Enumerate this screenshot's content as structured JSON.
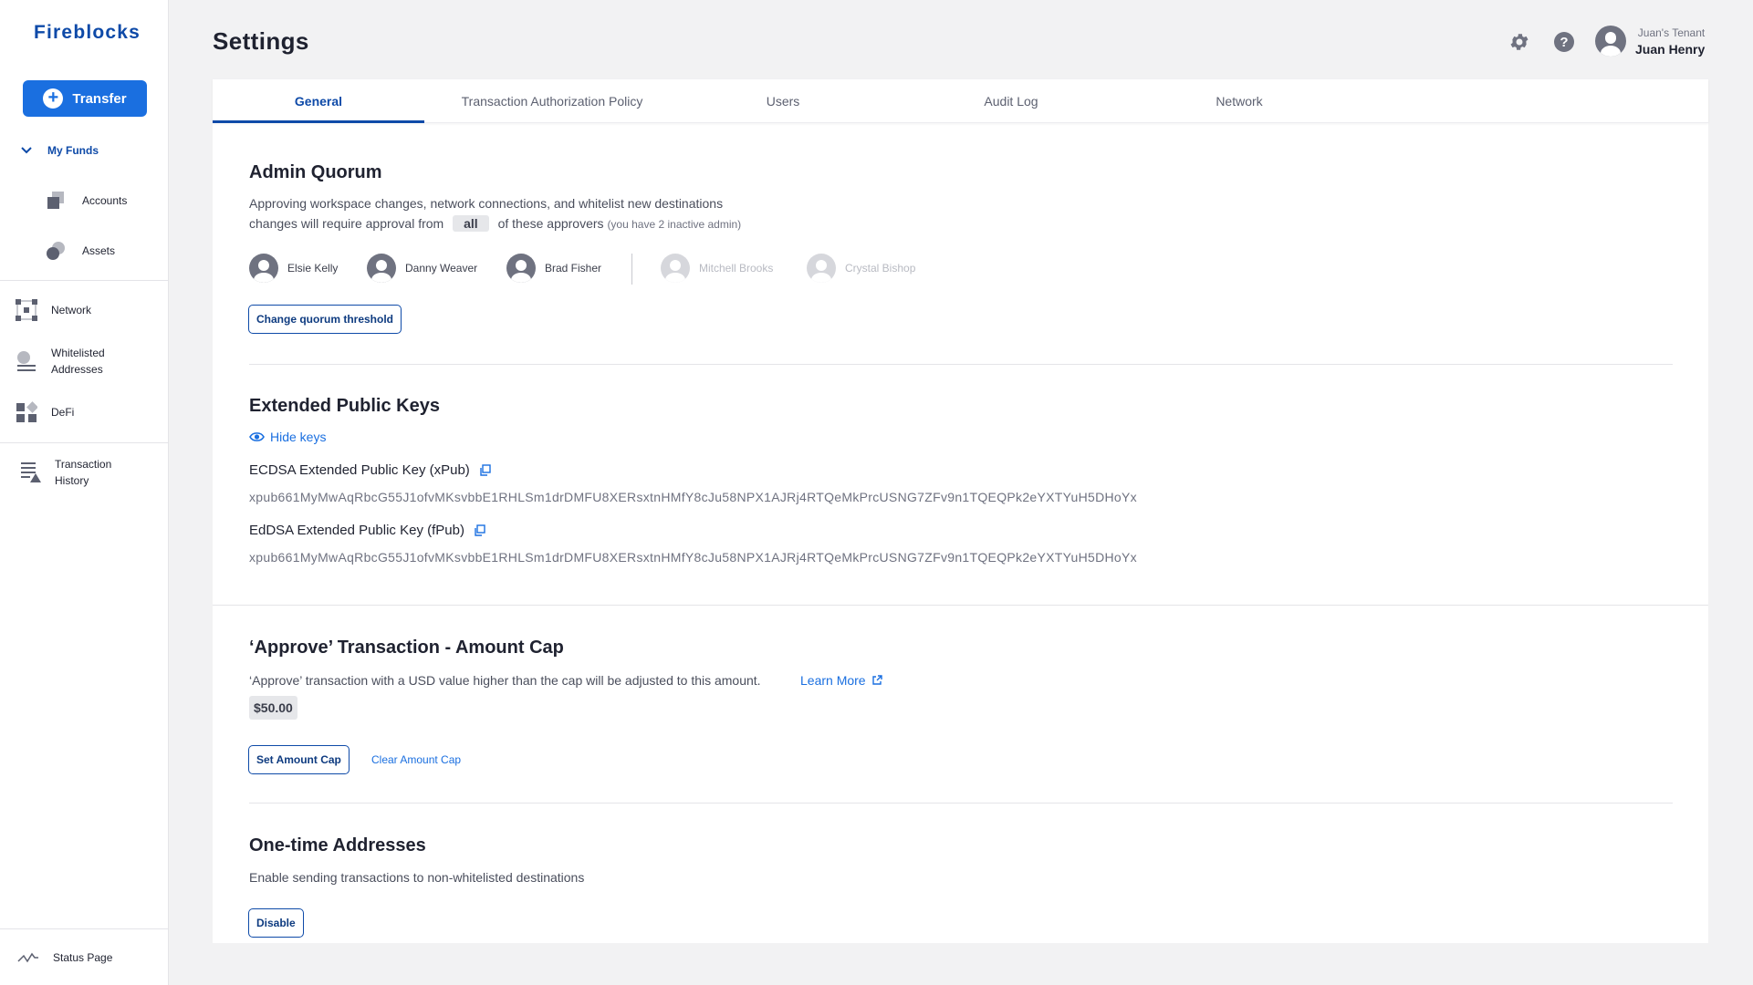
{
  "app": {
    "logo": "Fireblocks"
  },
  "sidebar": {
    "transfer_label": "Transfer",
    "my_funds": "My Funds",
    "items": [
      {
        "label": "Accounts",
        "icon": "accounts-icon"
      },
      {
        "label": "Assets",
        "icon": "assets-icon"
      },
      {
        "label": "Network",
        "icon": "network-icon"
      },
      {
        "label": "Whitelisted Addresses",
        "icon": "whitelist-icon"
      },
      {
        "label": "DeFi",
        "icon": "defi-icon"
      },
      {
        "label": "Transaction History",
        "icon": "history-icon"
      }
    ],
    "status_page": "Status Page"
  },
  "header": {
    "title": "Settings",
    "tenant": "Juan's Tenant",
    "user_name": "Juan Henry"
  },
  "tabs": [
    {
      "label": "General",
      "active": true
    },
    {
      "label": "Transaction Authorization Policy",
      "active": false
    },
    {
      "label": "Users",
      "active": false
    },
    {
      "label": "Audit Log",
      "active": false
    },
    {
      "label": "Network",
      "active": false
    }
  ],
  "quorum": {
    "title": "Admin Quorum",
    "line1": "Approving workspace changes, network  connections, and whitelist new destinations",
    "line2_pre": "changes will require approval from",
    "threshold": "all",
    "line2_post": "of these approvers",
    "note": "(you have 2 inactive admin)",
    "approvers": [
      {
        "name": "Elsie Kelly",
        "active": true
      },
      {
        "name": "Danny Weaver",
        "active": true
      },
      {
        "name": "Brad Fisher",
        "active": true
      },
      {
        "name": "Mitchell Brooks",
        "active": false
      },
      {
        "name": "Crystal Bishop",
        "active": false
      }
    ],
    "button": "Change quorum threshold"
  },
  "keys": {
    "title": "Extended Public Keys",
    "hide": "Hide keys",
    "ecdsa_label": "ECDSA Extended Public Key (xPub)",
    "ecdsa_value": "xpub661MyMwAqRbcG55J1ofvMKsvbbE1RHLSm1drDMFU8XERsxtnHMfY8cJu58NPX1AJRj4RTQeMkPrcUSNG7ZFv9n1TQEQPk2eYXTYuH5DHoYx",
    "eddsa_label": "EdDSA Extended Public Key (fPub)",
    "eddsa_value": "xpub661MyMwAqRbcG55J1ofvMKsvbbE1RHLSm1drDMFU8XERsxtnHMfY8cJu58NPX1AJRj4RTQeMkPrcUSNG7ZFv9n1TQEQPk2eYXTYuH5DHoYx"
  },
  "cap": {
    "title": "‘Approve’ Transaction - Amount Cap",
    "desc": "‘Approve’ transaction with a USD value higher than the cap will be adjusted to this amount.",
    "learn_more": "Learn More",
    "amount": "$50.00",
    "set_button": "Set Amount Cap",
    "clear_button": "Clear Amount Cap"
  },
  "onetime": {
    "title": "One-time Addresses",
    "desc": "Enable sending transactions to non-whitelisted destinations",
    "button": "Disable"
  },
  "colors": {
    "brand": "#0e4aa8",
    "accent": "#1a6fe0"
  }
}
